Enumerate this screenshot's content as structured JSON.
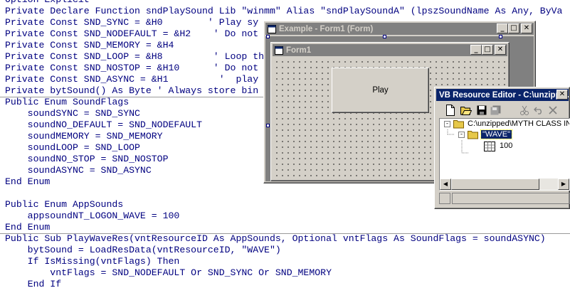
{
  "code": {
    "lines": [
      "Option Explicit",
      "Private Declare Function sndPlaySound Lib \"winmm\" Alias \"sndPlaySoundA\" (lpszSoundName As Any, ByVa",
      "Private Const SND_SYNC = &H0        ' Play sy",
      "Private Const SND_NODEFAULT = &H2    ' Do not",
      "Private Const SND_MEMORY = &H4",
      "Private Const SND_LOOP = &H8         ' Loop th",
      "Private Const SND_NOSTOP = &H10      ' Do not",
      "Private Const SND_ASYNC = &H1         '  play",
      "Private bytSound() As Byte ' Always store bin",
      "Public Enum SoundFlags",
      "    soundSYNC = SND_SYNC",
      "    soundNO_DEFAULT = SND_NODEFAULT",
      "    soundMEMORY = SND_MEMORY",
      "    soundLOOP = SND_LOOP",
      "    soundNO_STOP = SND_NOSTOP",
      "    soundASYNC = SND_ASYNC",
      "End Enum",
      "",
      "Public Enum AppSounds",
      "    appsoundNT_LOGON_WAVE = 100",
      "End Enum",
      "Public Sub PlayWaveRes(vntResourceID As AppSounds, Optional vntFlags As SoundFlags = soundASYNC)",
      "    bytSound = LoadResData(vntResourceID, \"WAVE\")",
      "    If IsMissing(vntFlags) Then",
      "        vntFlags = SND_NODEFAULT Or SND_SYNC Or SND_MEMORY",
      "    End If"
    ]
  },
  "form_designer": {
    "title": "Example - Form1 (Form)",
    "form_title": "Form1",
    "button_label": "Play"
  },
  "resource_editor": {
    "title": "VB Resource Editor - C:\\unzippe...",
    "tree": {
      "root": "C:\\unzipped\\MYTH CLASS IN",
      "folder": "\"WAVE\"",
      "item": "100"
    }
  },
  "window_buttons": {
    "minimize": "_",
    "maximize": "□",
    "close": "✕"
  },
  "icons": {
    "toolbar": [
      "new-icon",
      "open-icon",
      "save-icon",
      "save-all-icon",
      "cut-icon",
      "undo-icon",
      "delete-icon"
    ],
    "tree": [
      "folder-icon",
      "resource-icon"
    ]
  },
  "colors": {
    "code_text": "#000080",
    "active_title": "#0a246a",
    "inactive_title": "#808080",
    "window_face": "#d4d0c8",
    "selection": "#0a246a"
  }
}
